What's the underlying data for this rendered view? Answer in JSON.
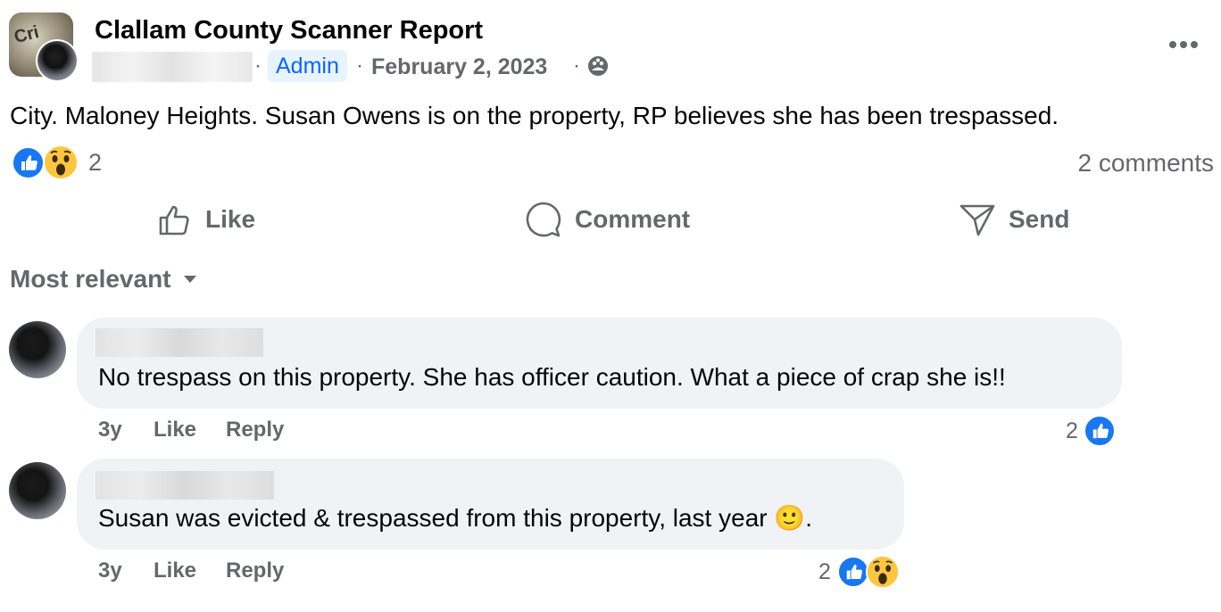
{
  "post": {
    "group_name": "Clallam County Scanner Report",
    "group_avatar_text": "Cri",
    "separator": "·",
    "badge": "Admin",
    "date": "February 2, 2023",
    "text": "City. Maloney Heights. Susan Owens is on the property, RP believes she has been trespassed.",
    "reaction_count": "2",
    "comments_count": "2 comments",
    "reactions": [
      "like-icon",
      "wow-icon"
    ]
  },
  "actions": {
    "like": "Like",
    "comment": "Comment",
    "send": "Send"
  },
  "sort_label": "Most relevant",
  "comments": [
    {
      "text": "No trespass on this property. She has officer caution. What a piece of crap she is!!",
      "age": "3y",
      "like": "Like",
      "reply": "Reply",
      "reaction_count": "2",
      "reactions": [
        "like-icon"
      ]
    },
    {
      "text": "Susan was evicted & trespassed from this property, last year 🙂.",
      "age": "3y",
      "like": "Like",
      "reply": "Reply",
      "reaction_count": "2",
      "reactions": [
        "like-icon",
        "wow-icon"
      ]
    }
  ],
  "colors": {
    "accent": "#1877f2",
    "admin_bg": "#e7f3ff",
    "admin_text": "#0866ff",
    "secondary_text": "#65676b",
    "bubble_bg": "#f0f2f5"
  }
}
